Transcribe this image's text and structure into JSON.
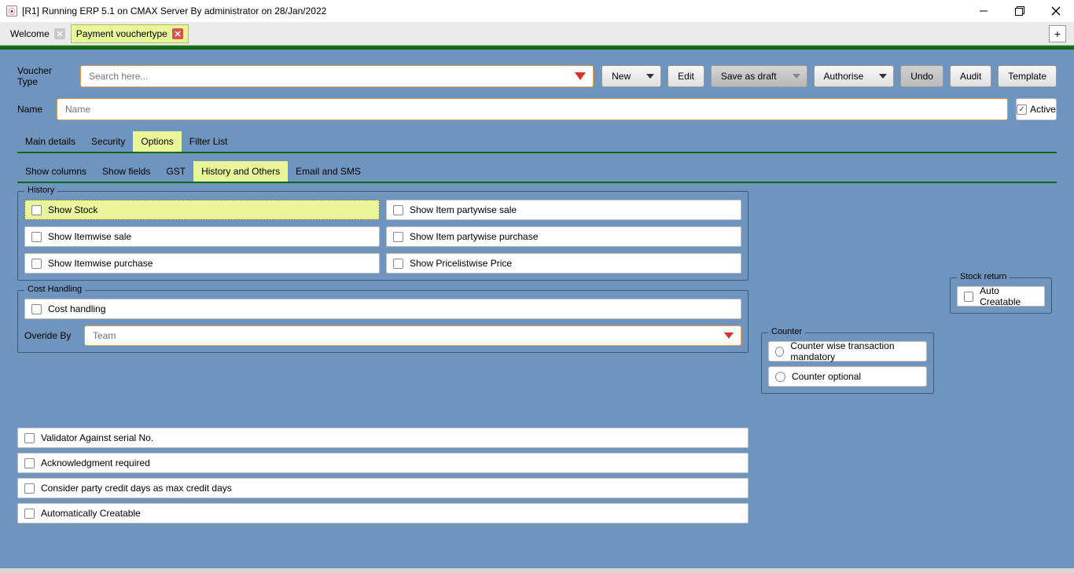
{
  "title": "[R1] Running ERP 5.1 on CMAX Server By administrator on 28/Jan/2022",
  "tabs": {
    "welcome": "Welcome",
    "payment": "Payment vouchertype"
  },
  "form": {
    "voucherTypeLabel": "Voucher Type",
    "searchPlaceholder": "Search here...",
    "nameLabel": "Name",
    "namePlaceholder": "Name",
    "activeLabel": "Active"
  },
  "toolbar": {
    "new": "New",
    "edit": "Edit",
    "saveDraft": "Save as draft",
    "authorise": "Authorise",
    "undo": "Undo",
    "audit": "Audit",
    "template": "Template"
  },
  "mainTabs": {
    "mainDetails": "Main details",
    "security": "Security",
    "options": "Options",
    "filterList": "Filter List"
  },
  "optionTabs": {
    "showColumns": "Show columns",
    "showFields": "Show fields",
    "gst": "GST",
    "historyOthers": "History and Others",
    "emailSms": "Email and SMS"
  },
  "history": {
    "legend": "History",
    "showStock": "Show Stock",
    "itemwiseSale": "Show Itemwise sale",
    "itemwisePurchase": "Show Itemwise purchase",
    "partywiseSale": "Show Item partywise sale",
    "partywisePurchase": "Show Item partywise purchase",
    "pricelistPrice": "Show Pricelistwise Price"
  },
  "costHandling": {
    "legend": "Cost Handling",
    "costHandling": "Cost handling",
    "overrideBy": "Overide By",
    "teamPlaceholder": "Team"
  },
  "stockReturn": {
    "legend": "Stock return",
    "autoCreatable": "Auto Creatable"
  },
  "counter": {
    "legend": "Counter",
    "mandatory": "Counter wise transaction mandatory",
    "optional": "Counter optional"
  },
  "misc": {
    "validatorSerial": "Validator Against serial No.",
    "ackRequired": "Acknowledgment required",
    "considerCredit": "Consider party credit days as max credit days",
    "autoCreatable": "Automatically Creatable"
  }
}
